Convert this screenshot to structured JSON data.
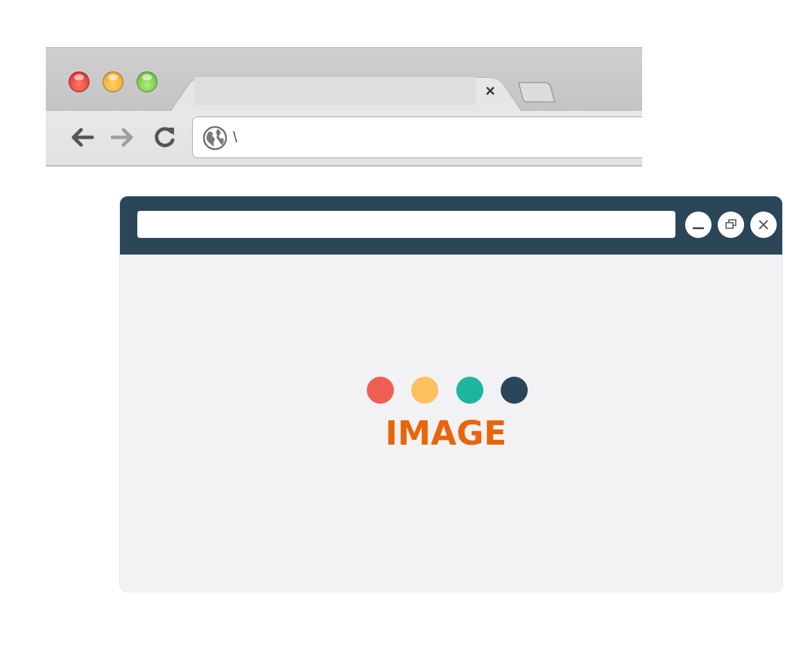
{
  "chrome_browser": {
    "tab": {
      "title": "",
      "close_glyph": "×"
    },
    "address_bar": {
      "value": "\\"
    },
    "icons": {
      "back": "arrow-left-icon",
      "forward": "arrow-right-icon",
      "reload": "reload-icon",
      "site": "globe-icon",
      "new_tab": "new-tab-icon"
    },
    "traffic_lights": [
      "#e0302a",
      "#f2ad2b",
      "#6cc63c"
    ]
  },
  "flat_window": {
    "address_bar": {
      "value": ""
    },
    "window_buttons": [
      "minimize-icon",
      "restore-icon",
      "close-icon"
    ],
    "titlebar_color": "#2b4559",
    "placeholder": {
      "dot_colors": [
        "#ee5e53",
        "#fbc15f",
        "#1db59f",
        "#2a465c"
      ],
      "label": "IMAGE",
      "label_color": "#e8650b"
    }
  }
}
